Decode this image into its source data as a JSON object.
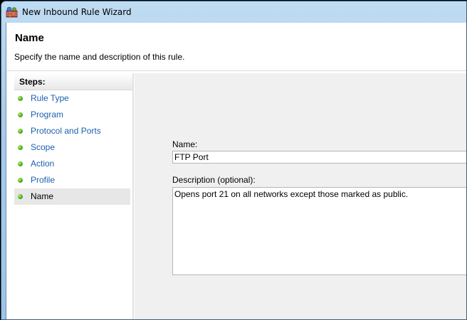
{
  "window": {
    "title": "New Inbound Rule Wizard",
    "icon": "firewall-wizard-icon"
  },
  "header": {
    "title": "Name",
    "subtitle": "Specify the name and description of this rule."
  },
  "steps": {
    "heading": "Steps:",
    "items": [
      {
        "label": "Rule Type",
        "current": false
      },
      {
        "label": "Program",
        "current": false
      },
      {
        "label": "Protocol and Ports",
        "current": false
      },
      {
        "label": "Scope",
        "current": false
      },
      {
        "label": "Action",
        "current": false
      },
      {
        "label": "Profile",
        "current": false
      },
      {
        "label": "Name",
        "current": true
      }
    ]
  },
  "form": {
    "name_label": "Name:",
    "name_value": "FTP Port",
    "description_label": "Description (optional):",
    "description_value": "Opens port 21 on all networks except those marked as public."
  },
  "colors": {
    "link": "#1d5fae",
    "step_dot": "#4fb01a",
    "content_bg": "#f0f0f0"
  }
}
